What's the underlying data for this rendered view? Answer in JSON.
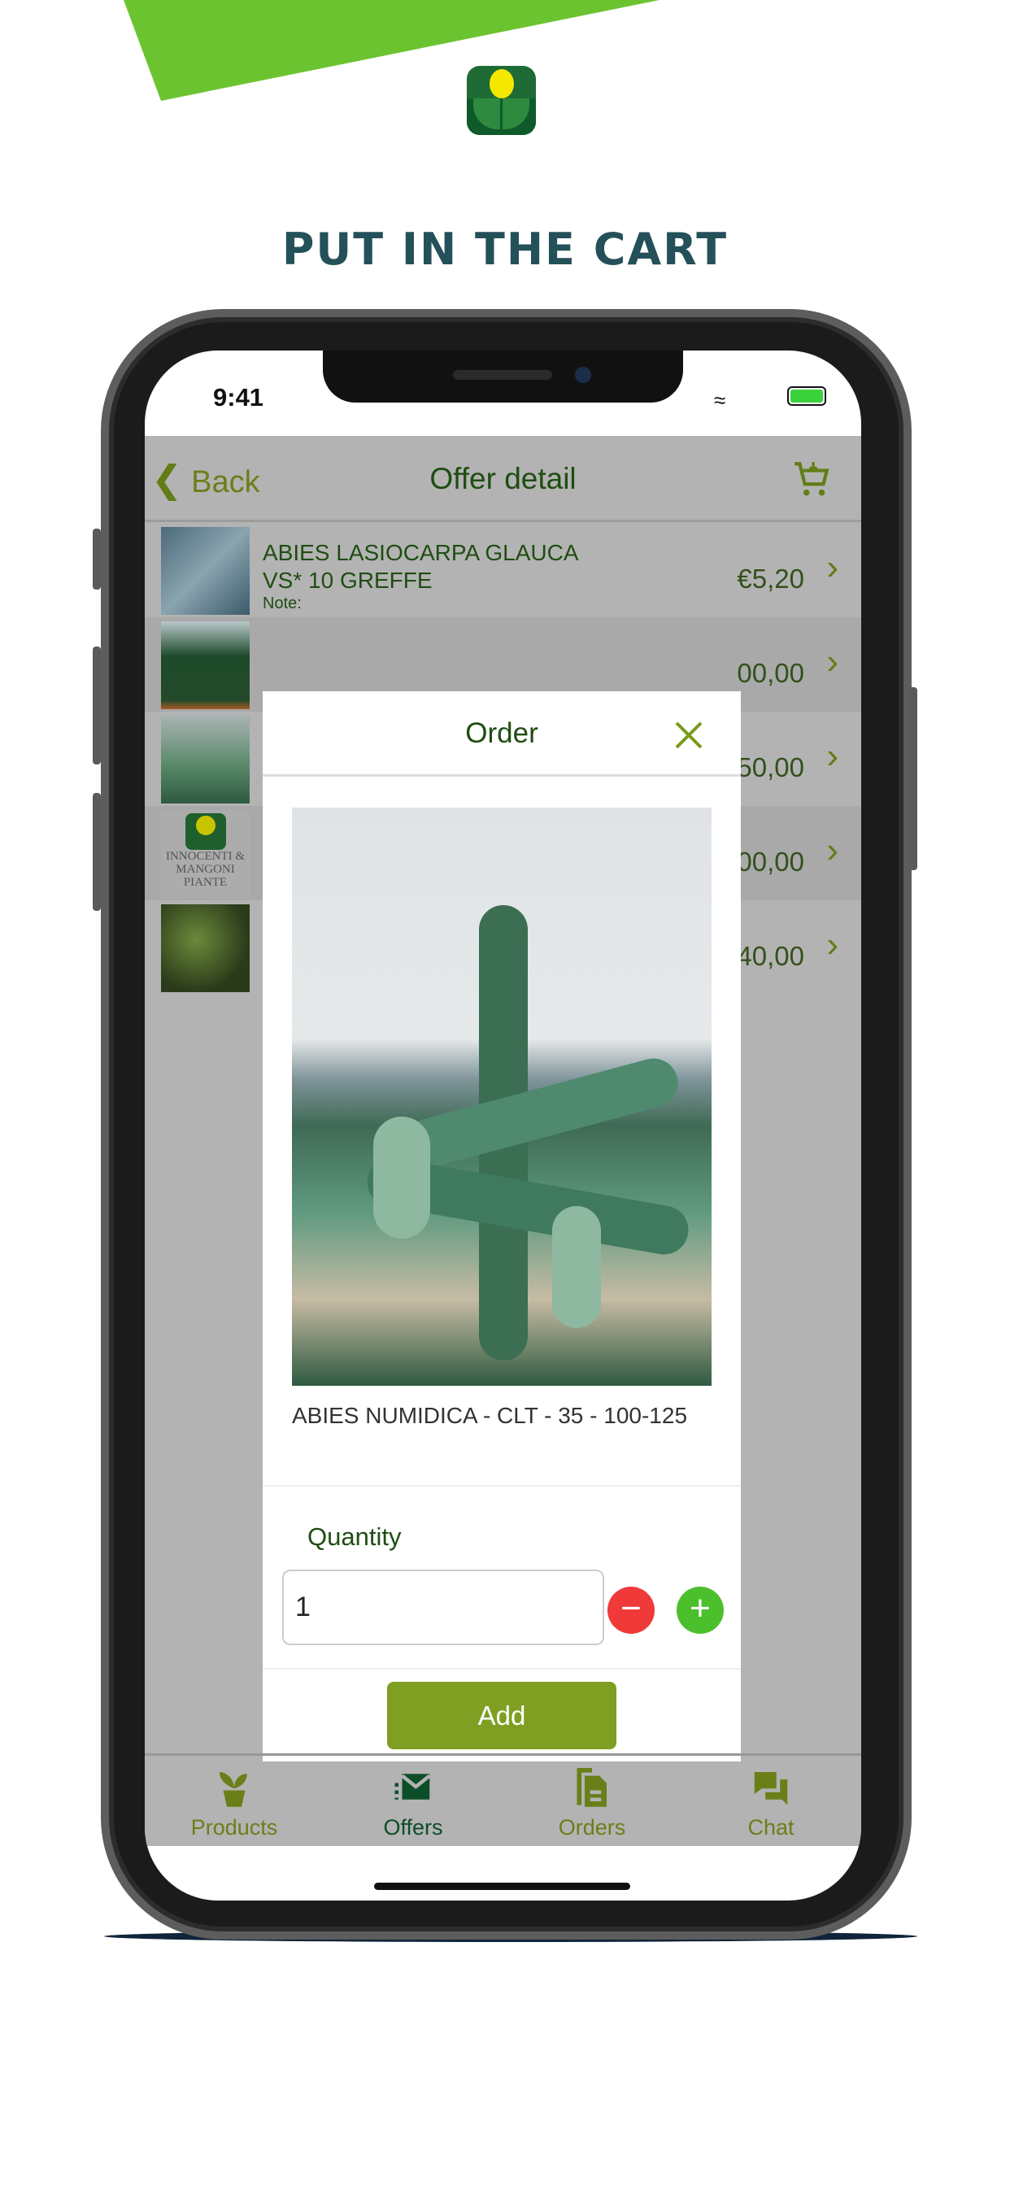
{
  "headline": "PUT IN THE CART",
  "status_bar": {
    "time": "9:41"
  },
  "nav": {
    "back_label": "Back",
    "title": "Offer detail",
    "cart_icon": "cart-add-icon"
  },
  "list": {
    "rows": [
      {
        "name_line1": "ABIES LASIOCARPA GLAUCA",
        "name_line2": "VS* 10 GREFFE",
        "note": "Note:",
        "price": "€5,20"
      },
      {
        "price": "00,00"
      },
      {
        "price": "50,00"
      },
      {
        "price": "00,00",
        "thumb_text": "INNOCENTI & MANGONI PIANTE"
      },
      {
        "price": "40,00"
      }
    ]
  },
  "modal": {
    "title": "Order",
    "close_icon": "close-icon",
    "product_name": "ABIES NUMIDICA - CLT - 35 - 100-125",
    "quantity_label": "Quantity",
    "quantity_value": "1",
    "minus_icon": "minus-icon",
    "plus_icon": "plus-icon",
    "add_label": "Add"
  },
  "tabs": [
    {
      "label": "Products",
      "icon": "plant-pot-icon",
      "active": false
    },
    {
      "label": "Offers",
      "icon": "envelope-offer-icon",
      "active": true
    },
    {
      "label": "Orders",
      "icon": "documents-icon",
      "active": false
    },
    {
      "label": "Chat",
      "icon": "chat-bubbles-icon",
      "active": false
    }
  ],
  "colors": {
    "brand_green": "#6b8e23",
    "dark_green": "#1f5f2d",
    "lime": "#6cc330",
    "minus_red": "#f03a3a",
    "plus_green": "#4cbf2c"
  }
}
